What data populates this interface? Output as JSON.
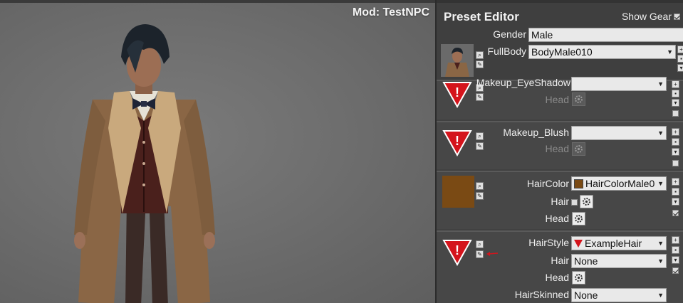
{
  "viewport": {
    "mod_label": "Mod: TestNPC"
  },
  "panel": {
    "title": "Preset Editor",
    "show_gear_label": "Show Gear",
    "show_gear_checked": true,
    "gender": {
      "label": "Gender",
      "value": "Male"
    },
    "fullbody": {
      "label": "FullBody",
      "value": "BodyMale010"
    }
  },
  "sections": {
    "eyeshadow": {
      "label": "Makeup_EyeShadow",
      "value": "",
      "head_label": "Head"
    },
    "blush": {
      "label": "Makeup_Blush",
      "value": "",
      "head_label": "Head"
    },
    "haircolor": {
      "label": "HairColor",
      "value": "HairColorMale0",
      "hair_label": "Hair",
      "head_label": "Head",
      "swatch_color": "#7a4a14"
    },
    "hairstyle": {
      "label": "HairStyle",
      "value": "ExampleHair",
      "hair_label": "Hair",
      "hair_value": "None",
      "head_label": "Head",
      "hairskinned_label": "HairSkinned",
      "hairskinned_value": "None"
    }
  },
  "icons": {
    "search": "magnifier-icon",
    "edit": "edit-icon",
    "gear": "gear-icon",
    "warning": "warning-triangle-icon",
    "add": "add-icon",
    "save": "save-icon",
    "delete": "delete-icon"
  },
  "colors": {
    "panel_bg": "#414141",
    "warning_red": "#d4141c",
    "hair_color": "#7a4a14"
  }
}
